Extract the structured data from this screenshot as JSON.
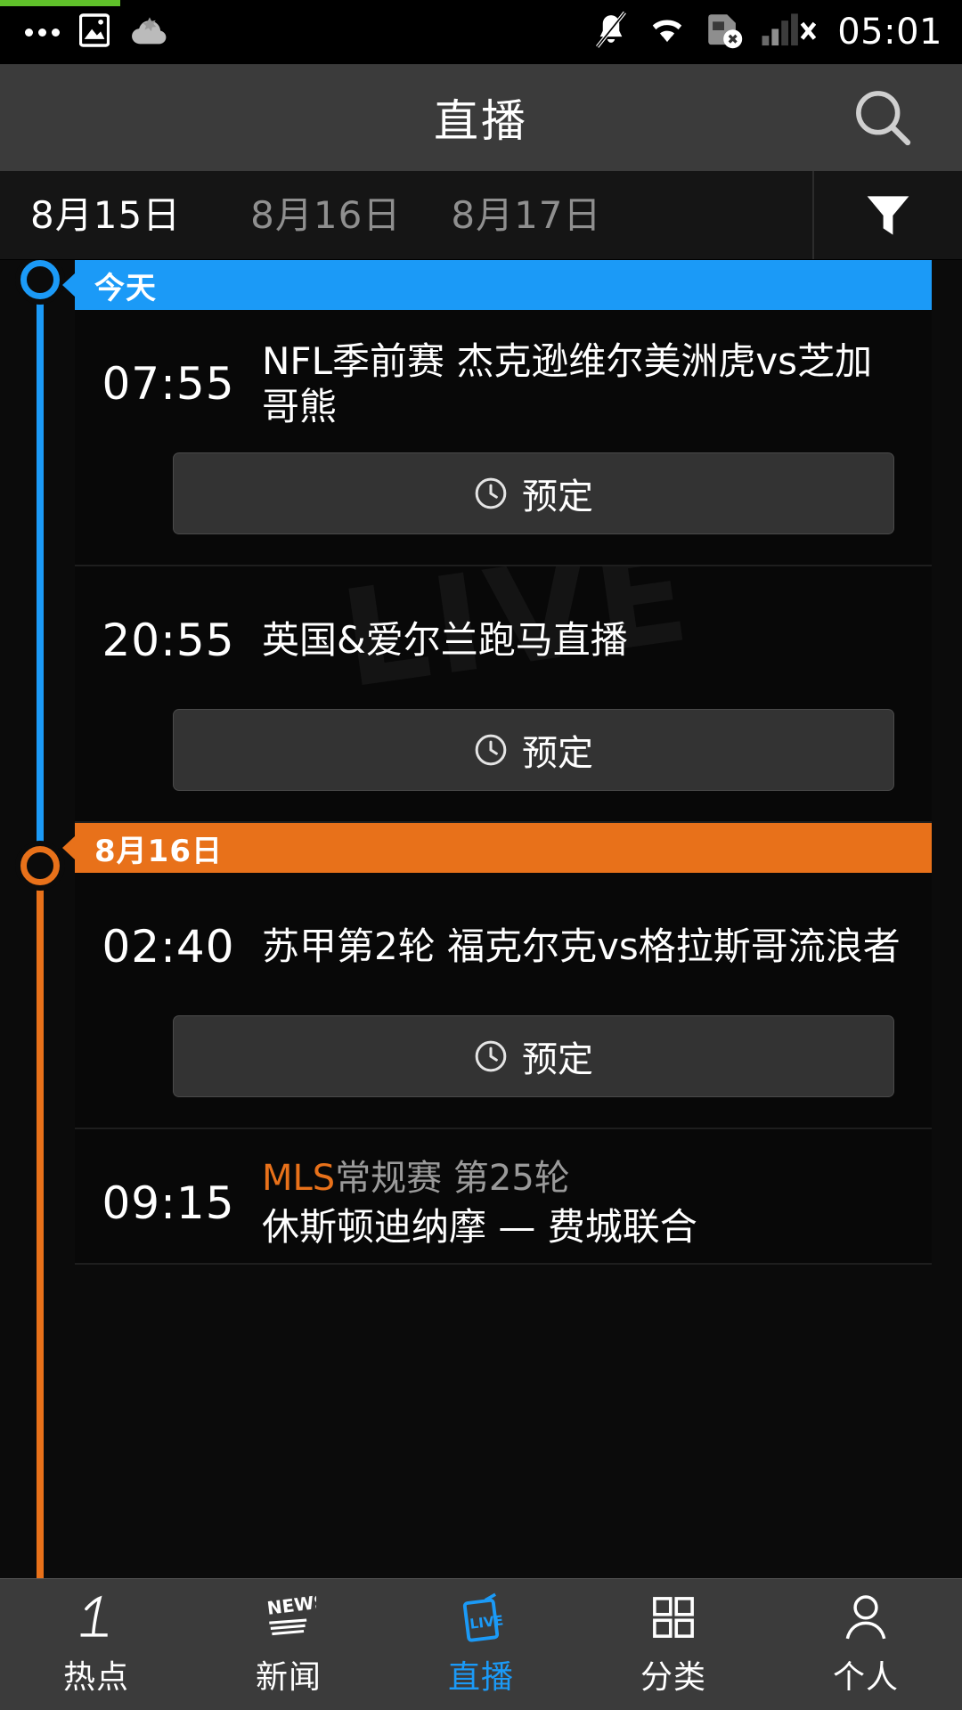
{
  "status_bar": {
    "time": "05:01",
    "left_icons": [
      "more-dots-icon",
      "image-icon",
      "cloud-icon"
    ],
    "right_icons": [
      "mute-bell-icon",
      "wifi-icon",
      "sim-error-icon",
      "signal-off-icon"
    ],
    "progress_color": "#5fc12a"
  },
  "header": {
    "title": "直播",
    "search_icon": "search-icon"
  },
  "date_bar": {
    "tabs": [
      {
        "label": "8月15日",
        "active": true
      },
      {
        "label": "8月16日",
        "active": false
      },
      {
        "label": "8月17日",
        "active": false
      }
    ],
    "filter_icon": "filter-icon"
  },
  "colors": {
    "today_accent": "#1b9af7",
    "next_day_accent": "#e8711a",
    "header_bg": "#3b3b3b",
    "card_bg": "#080808"
  },
  "timeline": [
    {
      "banner": "今天",
      "accent": "#1b9af7",
      "events": [
        {
          "time": "07:55",
          "title": "NFL季前赛 杰克逊维尔美洲虎vs芝加哥熊",
          "reserve_label": "预定",
          "reserve_icon": "clock-icon",
          "watermark": "LIVE"
        },
        {
          "time": "20:55",
          "title": "英国&爱尔兰跑马直播",
          "reserve_label": "预定",
          "reserve_icon": "clock-icon",
          "watermark": "LIVE"
        }
      ]
    },
    {
      "banner": "8月16日",
      "accent": "#e8711a",
      "events": [
        {
          "time": "02:40",
          "title": "苏甲第2轮 福克尔克vs格拉斯哥流浪者",
          "reserve_label": "预定",
          "reserve_icon": "clock-icon",
          "watermark": ""
        },
        {
          "time": "09:15",
          "league_accent": "MLS",
          "league_rest": "常规赛 第25轮",
          "teams": "休斯顿迪纳摩 — 费城联合",
          "watermark": ""
        }
      ]
    }
  ],
  "bottom_nav": [
    {
      "label": "热点",
      "icon": "numeral-one-icon",
      "active": false
    },
    {
      "label": "新闻",
      "icon": "news-icon",
      "active": false
    },
    {
      "label": "直播",
      "icon": "live-icon",
      "active": true
    },
    {
      "label": "分类",
      "icon": "grid-icon",
      "active": false
    },
    {
      "label": "个人",
      "icon": "person-icon",
      "active": false
    }
  ]
}
